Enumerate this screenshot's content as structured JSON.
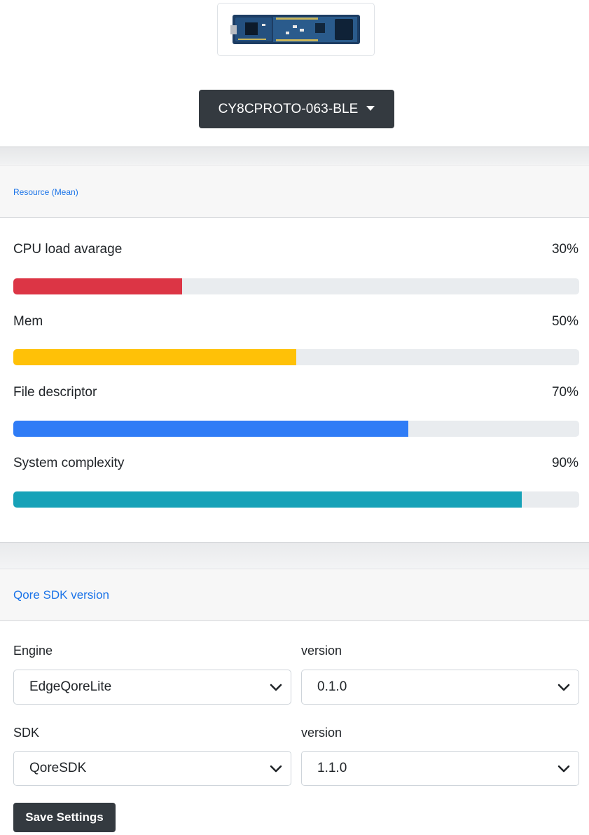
{
  "device": {
    "image_name": "board-image",
    "selected": "CY8CPROTO-063-BLE"
  },
  "resource": {
    "header": "Resource (Mean)",
    "items": [
      {
        "label": "CPU load avarage",
        "value": "30%",
        "color": "#dc3545"
      },
      {
        "label": "Mem",
        "value": "50%",
        "color": "#ffc107"
      },
      {
        "label": "File descriptor",
        "value": "70%",
        "color": "#2f7cf6"
      },
      {
        "label": "System complexity",
        "value": "90%",
        "color": "#17a2b8"
      }
    ],
    "fill_fractions": [
      0.298,
      0.5,
      0.698,
      0.898
    ]
  },
  "sdk": {
    "header": "Qore SDK version",
    "engine_label": "Engine",
    "engine_value": "EdgeQoreLite",
    "engine_version_label": "version",
    "engine_version_value": "0.1.0",
    "sdk_label": "SDK",
    "sdk_value": "QoreSDK",
    "sdk_version_label": "version",
    "sdk_version_value": "1.1.0",
    "save_label": "Save Settings"
  }
}
